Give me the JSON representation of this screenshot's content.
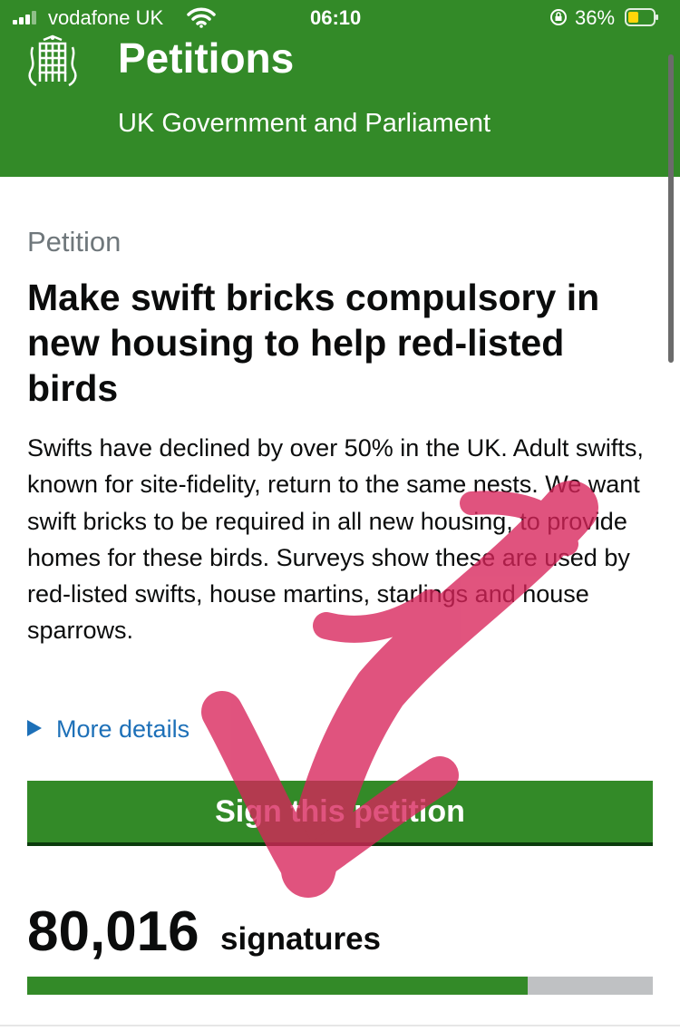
{
  "status_bar": {
    "carrier": "vodafone UK",
    "time": "06:10",
    "battery_percent": "36%"
  },
  "header": {
    "title": "Petitions",
    "subtitle": "UK Government and Parliament",
    "logo_icon": "portcullis-icon"
  },
  "petition": {
    "kicker": "Petition",
    "title": "Make swift bricks compulsory in new housing to help red-listed birds",
    "body": "Swifts have declined by over 50% in the UK. Adult swifts, known for site-fidelity, return to the same nests. We want swift bricks to be required in all new housing, to provide homes for these birds. Surveys show these are used by red-listed swifts, house martins, starlings and house sparrows.",
    "more_details": "More details",
    "sign_button": "Sign this petition"
  },
  "signatures": {
    "count": "80,016",
    "label": "signatures",
    "progress_fraction": 0.8
  },
  "colors": {
    "brand_green": "#338a28",
    "link_blue": "#1d70b8",
    "annotation_pink": "#d8245a"
  }
}
